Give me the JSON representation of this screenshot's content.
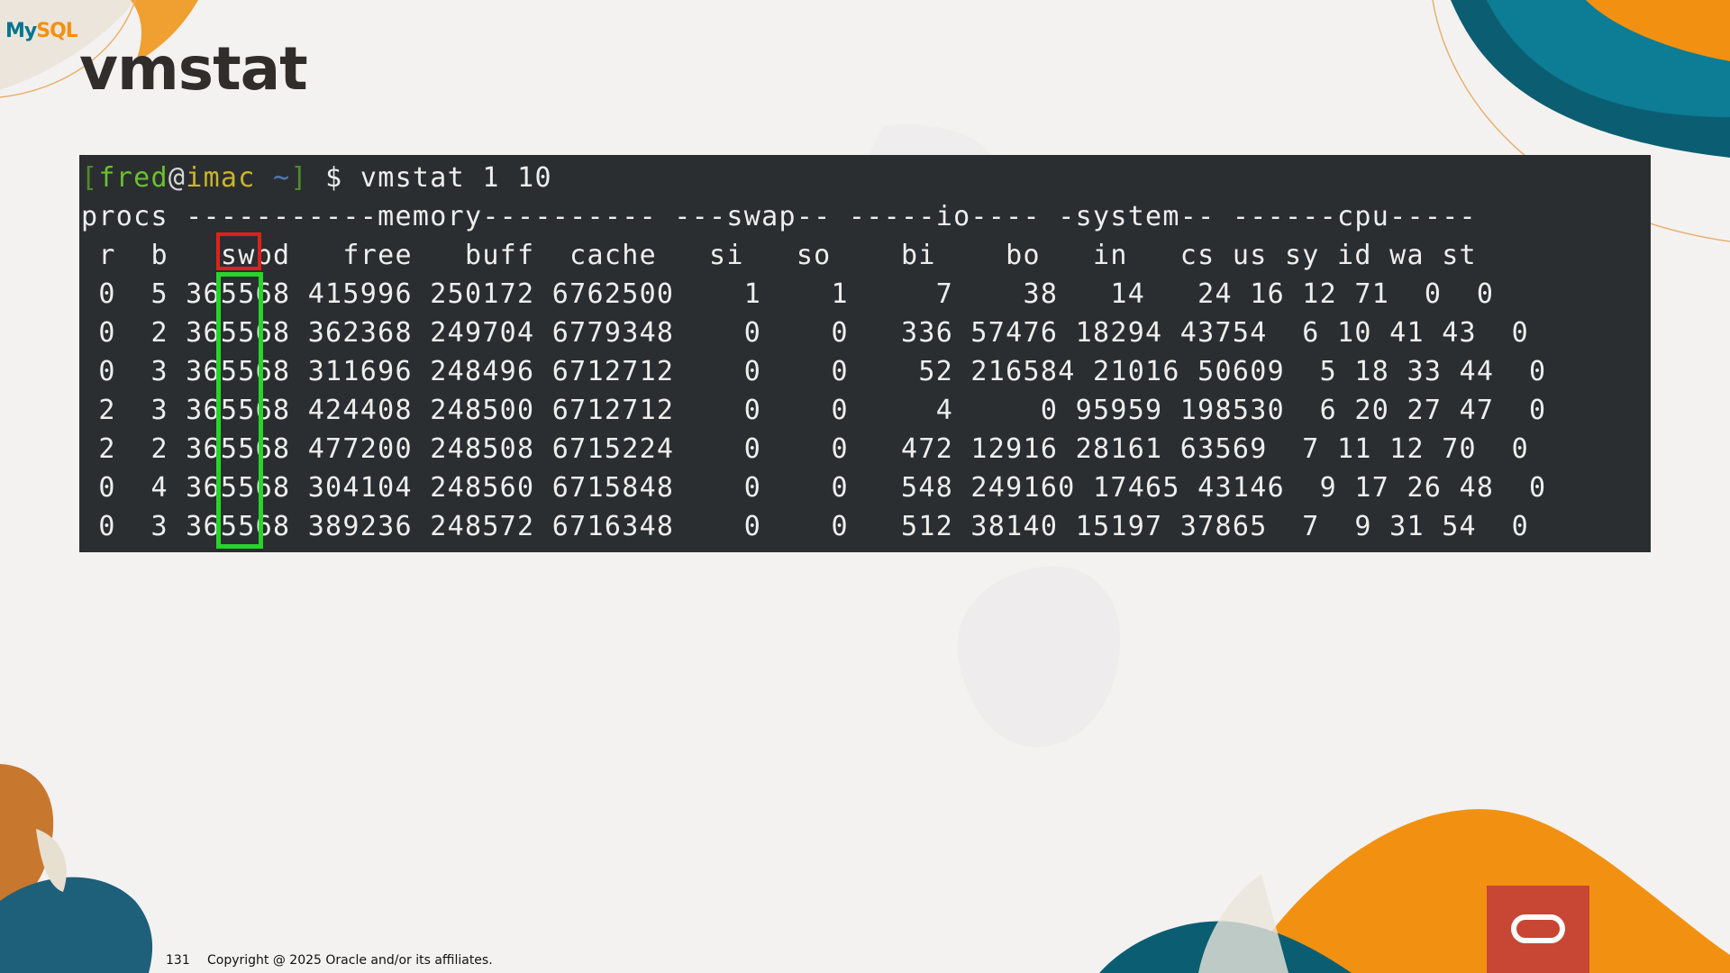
{
  "slide": {
    "title": "vmstat",
    "logo": {
      "my": "My",
      "sql": "SQL"
    },
    "page_number": "131",
    "copyright": "Copyright @ 2025 Oracle and/or its affiliates.",
    "colors": {
      "background": "#f4f2f1",
      "terminal_bg": "#2b2e30",
      "highlight_header": "#e0201c",
      "highlight_column": "#26d52a",
      "oracle_red": "#c74634",
      "teal": "#00758f",
      "orange": "#f29111"
    }
  },
  "terminal": {
    "prompt": {
      "open_bracket": "[",
      "user": "fred",
      "at": "@",
      "host": "imac",
      "path": " ~",
      "close_bracket": "]",
      "command": " $ vmstat 1 10"
    },
    "group_header": "procs -----------memory---------- ---swap-- -----io---- -system-- ------cpu-----",
    "column_header": " r  b   swpd   free   buff  cache   si   so    bi    bo   in   cs us sy id wa st",
    "rows": [
      " 0  5 365568 415996 250172 6762500    1    1     7    38   14   24 16 12 71  0  0",
      " 0  2 365568 362368 249704 6779348    0    0   336 57476 18294 43754  6 10 41 43  0",
      " 0  3 365568 311696 248496 6712712    0    0    52 216584 21016 50609  5 18 33 44  0",
      " 2  3 365568 424408 248500 6712712    0    0     4     0 95959 198530  6 20 27 47  0",
      " 2  2 365568 477200 248508 6715224    0    0   472 12916 28161 63569  7 11 12 70  0",
      " 0  4 365568 304104 248560 6715848    0    0   548 249160 17465 43146  9 17 26 48  0",
      " 0  3 365568 389236 248572 6716348    0    0   512 38140 15197 37865  7  9 31 54  0"
    ],
    "highlighted_column": "b"
  }
}
